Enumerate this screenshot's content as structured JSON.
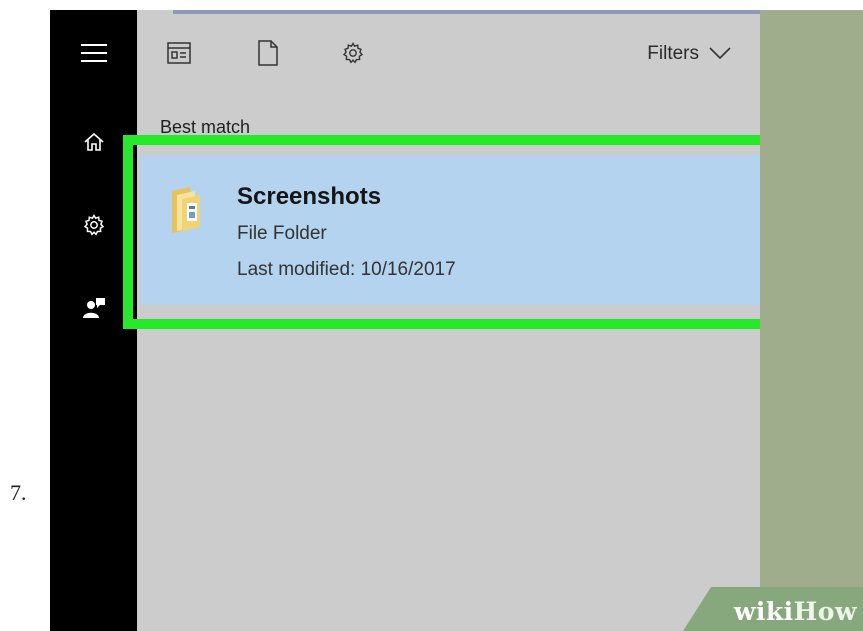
{
  "step": {
    "number": "7."
  },
  "sidebar": {
    "items": [
      {
        "icon": "hamburger-menu-icon"
      },
      {
        "icon": "home-icon"
      },
      {
        "icon": "gear-icon"
      },
      {
        "icon": "feedback-person-icon"
      }
    ]
  },
  "toolbar": {
    "icons": [
      "apps-icon",
      "documents-icon",
      "settings-icon"
    ],
    "filters_label": "Filters"
  },
  "results": {
    "section_label": "Best match",
    "items": [
      {
        "title": "Screenshots",
        "type": "File Folder",
        "modified": "Last modified: 10/16/2017",
        "icon": "folder-icon"
      }
    ]
  },
  "highlight": {
    "color": "#27e92b"
  },
  "watermark": {
    "wiki": "wiki",
    "how": "How"
  },
  "colors": {
    "selection": "#b3d3ee",
    "panel": "#cccccc",
    "sidebar": "#000000",
    "desktop": "#9fad8c"
  }
}
